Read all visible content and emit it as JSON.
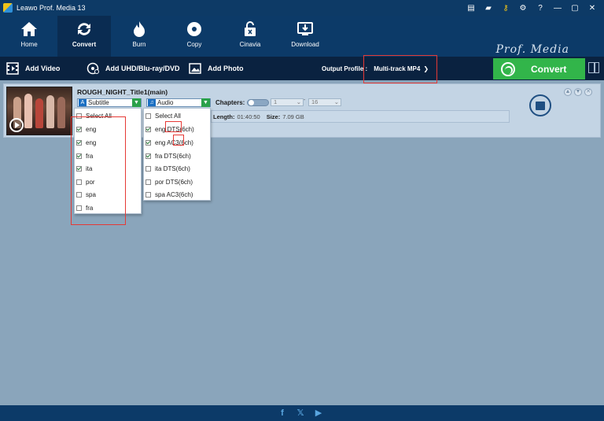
{
  "window": {
    "title": "Leawo Prof. Media 13"
  },
  "nav": {
    "items": [
      {
        "label": "Home"
      },
      {
        "label": "Convert"
      },
      {
        "label": "Burn"
      },
      {
        "label": "Copy"
      },
      {
        "label": "Cinavia"
      },
      {
        "label": "Download"
      }
    ],
    "active": "Convert",
    "brand": "Prof. Media"
  },
  "toolbar": {
    "add_video": "Add Video",
    "add_disc": "Add UHD/Blu-ray/DVD",
    "add_photo": "Add Photo",
    "output_profile_label": "Output Profile :",
    "output_profile_value": "Multi-track MP4",
    "convert_label": "Convert"
  },
  "video": {
    "title": "ROUGH_NIGHT_Title1(main)",
    "subtitle_combo": "Subtitle",
    "audio_combo": "Audio",
    "chapters_label": "Chapters:",
    "chapter_from": "1",
    "chapter_sep": "-",
    "chapter_to": "16",
    "length_label": "Length:",
    "length_value": "01:40:50",
    "size_label": "Size:",
    "size_value": "7.09 GB"
  },
  "subtitle_list": {
    "select_all": "Select All",
    "items": [
      {
        "label": "eng",
        "checked": true
      },
      {
        "label": "eng",
        "checked": true
      },
      {
        "label": "fra",
        "checked": true
      },
      {
        "label": "ita",
        "checked": true
      },
      {
        "label": "por",
        "checked": false
      },
      {
        "label": "spa",
        "checked": false
      },
      {
        "label": "fra",
        "checked": false
      }
    ]
  },
  "audio_list": {
    "select_all": "Select All",
    "items": [
      {
        "label": "eng DTS(6ch)",
        "checked": true
      },
      {
        "label": "eng AC3(6ch)",
        "checked": true
      },
      {
        "label": "fra DTS(6ch)",
        "checked": true
      },
      {
        "label": "ita DTS(6ch)",
        "checked": false
      },
      {
        "label": "por DTS(6ch)",
        "checked": false
      },
      {
        "label": "spa AC3(6ch)",
        "checked": false
      }
    ]
  },
  "footer": {
    "icons": [
      "facebook-icon",
      "x-twitter-icon",
      "youtube-icon"
    ]
  },
  "colors": {
    "titlebar": "#0d3a66",
    "toolbar": "#0a2240",
    "convert_green": "#32b54a",
    "highlight_red": "#e53935",
    "workspace": "#8aa5bb"
  }
}
